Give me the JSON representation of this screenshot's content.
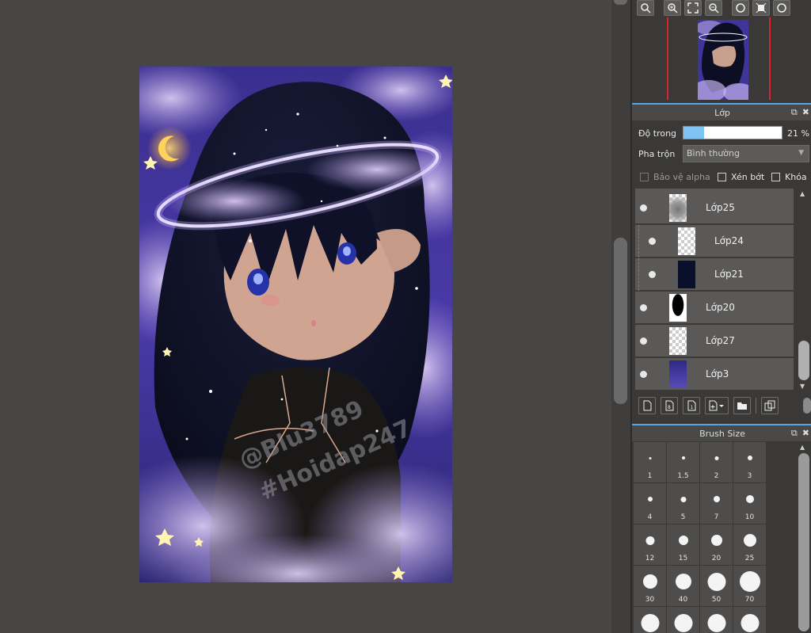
{
  "navigator": {
    "toolbar_icons": [
      "zoom-actual-icon",
      "zoom-in-icon",
      "fit-window-icon",
      "zoom-out-icon",
      "rotate-left-icon",
      "fit-center-icon",
      "rotate-right-icon"
    ]
  },
  "layers_panel": {
    "title": "Lớp",
    "opacity_label": "Độ trong",
    "opacity_value": "21 %",
    "opacity_fraction": 0.21,
    "blend_label": "Pha trộn",
    "blend_value": "Bình thường",
    "protect_alpha": "Bảo vệ alpha",
    "clipping": "Xén bớt",
    "lock": "Khóa",
    "layers": [
      {
        "name": "Lớp25",
        "clipped": false,
        "thumb": "clouds"
      },
      {
        "name": "Lớp24",
        "clipped": true,
        "thumb": "transparent"
      },
      {
        "name": "Lớp21",
        "clipped": true,
        "thumb": "dark"
      },
      {
        "name": "Lớp20",
        "clipped": false,
        "thumb": "silhouette"
      },
      {
        "name": "Lớp27",
        "clipped": false,
        "thumb": "transparent"
      },
      {
        "name": "Lớp3",
        "clipped": false,
        "thumb": "gradient"
      }
    ],
    "toolbar_icons": [
      "new-layer-icon",
      "new-layer-8bit-icon",
      "new-layer-1bit-icon",
      "add-layer-menu-icon",
      "new-folder-icon",
      "duplicate-layer-icon"
    ]
  },
  "brush_panel": {
    "title": "Brush Size",
    "sizes": [
      "1",
      "1.5",
      "2",
      "3",
      "4",
      "5",
      "7",
      "10",
      "12",
      "15",
      "20",
      "25",
      "30",
      "40",
      "50",
      "70",
      "",
      "",
      "",
      ""
    ]
  },
  "watermark": {
    "line1": "@Blu3789",
    "line2": "#Hoidap247"
  },
  "colors": {
    "accent": "#58a5e0",
    "navigator_frame": "#d8252a",
    "opacity_fill": "#7ec3f1"
  }
}
